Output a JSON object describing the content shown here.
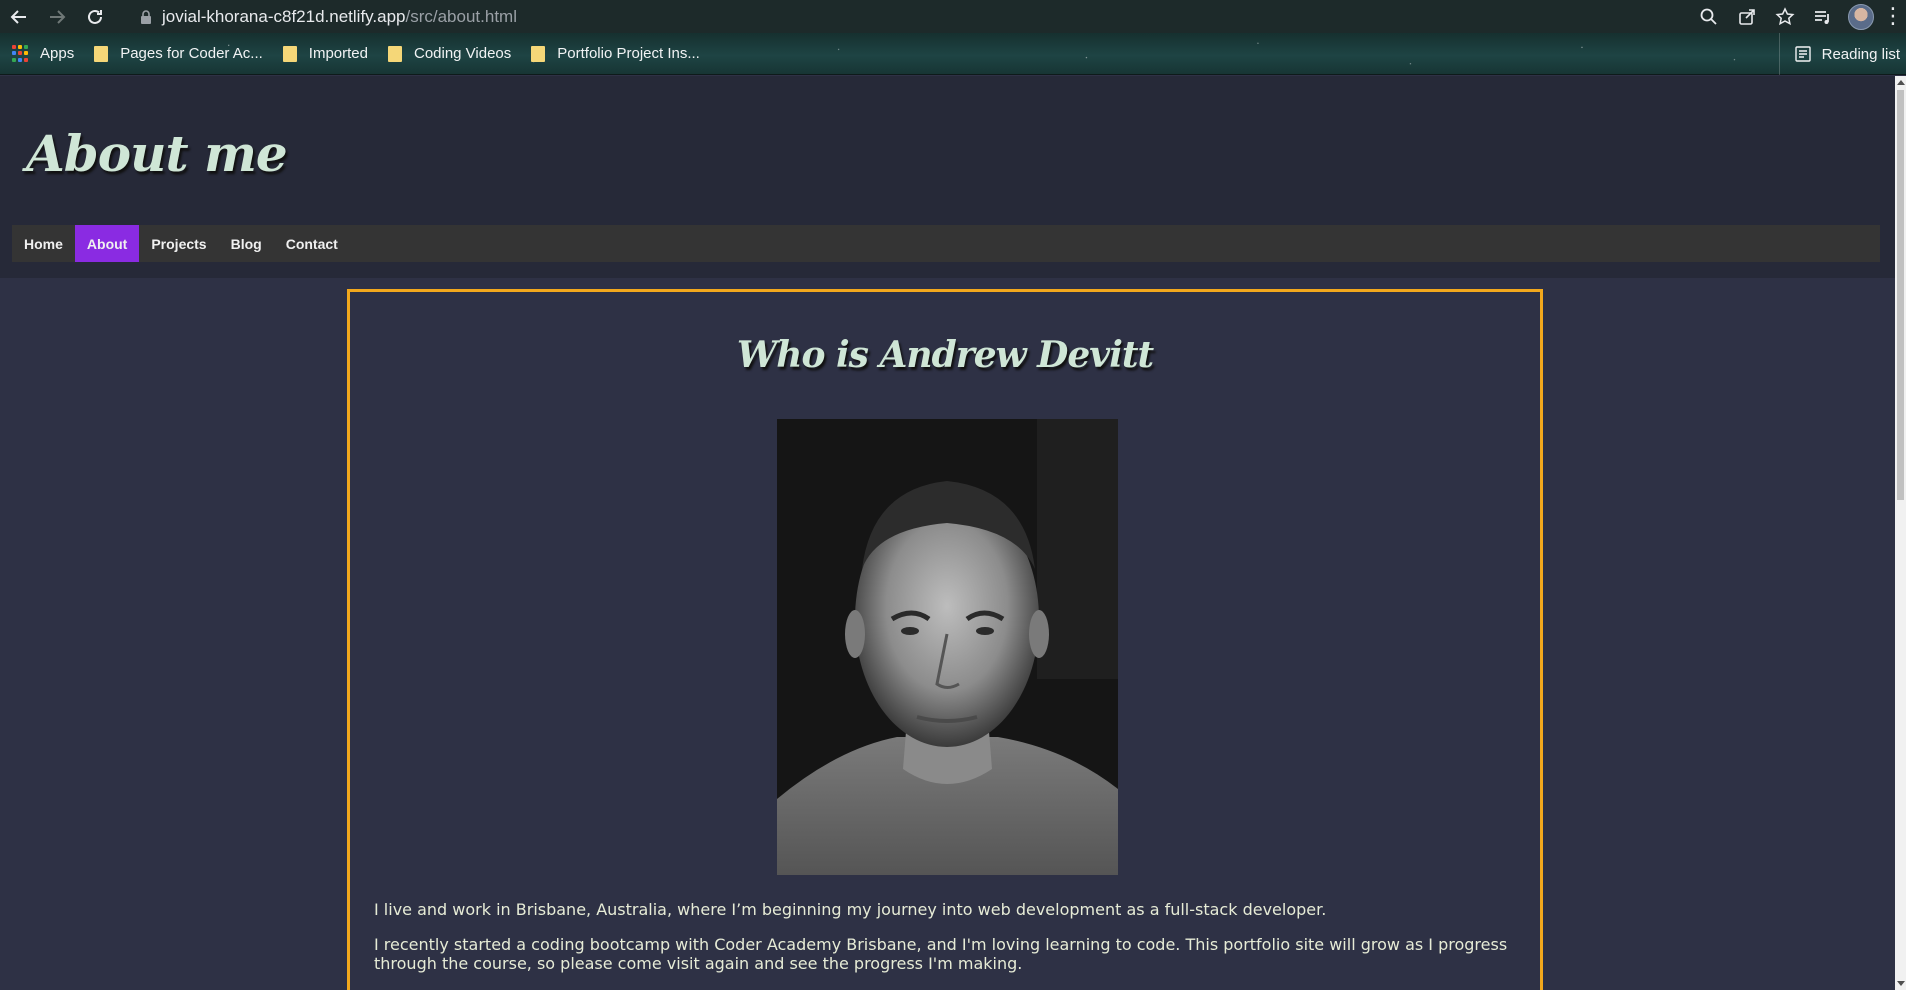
{
  "browser": {
    "url_host": "jovial-khorana-c8f21d.netlify.app",
    "url_path": "/src/about.html",
    "bookmarks": [
      {
        "label": "Apps",
        "icon": "apps-grid-icon"
      },
      {
        "label": "Pages for Coder Ac...",
        "icon": "folder-icon"
      },
      {
        "label": "Imported",
        "icon": "folder-icon"
      },
      {
        "label": "Coding Videos",
        "icon": "folder-icon"
      },
      {
        "label": "Portfolio Project Ins...",
        "icon": "folder-icon"
      }
    ],
    "reading_list_label": "Reading list"
  },
  "site": {
    "title": "About me",
    "nav": [
      {
        "label": "Home",
        "active": false
      },
      {
        "label": "About",
        "active": true
      },
      {
        "label": "Projects",
        "active": false
      },
      {
        "label": "Blog",
        "active": false
      },
      {
        "label": "Contact",
        "active": false
      }
    ]
  },
  "content": {
    "heading": "Who is Andrew Devitt",
    "paragraphs": [
      "I live and work in Brisbane, Australia, where I’m beginning my journey into web development as a full-stack developer.",
      "I recently started a coding bootcamp with Coder Academy Brisbane, and I'm loving learning to code. This portfolio site will grow as I progress through the course, so please come visit again and see the progress I'm making."
    ]
  },
  "colors": {
    "accent_nav_active": "#8a2be2",
    "card_border": "#f2a81d",
    "title_text": "#cfe6d6",
    "page_background": "#2e3145",
    "header_background": "#262938"
  }
}
